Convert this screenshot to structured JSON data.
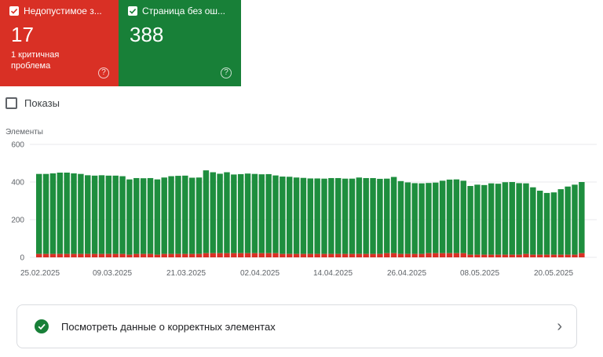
{
  "cards": {
    "invalid": {
      "label": "Недопустимое з...",
      "count": "17",
      "sub": "1 критичная проблема",
      "color": "#d93025"
    },
    "valid": {
      "label": "Страница без ош...",
      "count": "388",
      "color": "#188038"
    }
  },
  "shows_label": "Показы",
  "bottom_link": {
    "label": "Посмотреть данные о корректных элементах"
  },
  "chart_data": {
    "type": "bar",
    "ylabel": "Элементы",
    "ylim": [
      0,
      600
    ],
    "yticks": [
      "600",
      "400",
      "200",
      "0"
    ],
    "xticks": [
      "25.02.2025",
      "09.03.2025",
      "21.03.2025",
      "02.04.2025",
      "14.04.2025",
      "26.04.2025",
      "08.05.2025",
      "20.05.2025"
    ],
    "colors": {
      "valid": "#1e8e3e",
      "invalid": "#d93025"
    },
    "series": [
      {
        "values": [
          425,
          425,
          428,
          432,
          432,
          428,
          425,
          418,
          416,
          418,
          416,
          416,
          413,
          400,
          403,
          402,
          403,
          400,
          406,
          413,
          415,
          416,
          405,
          406,
          440,
          430,
          422,
          430,
          418,
          420,
          423,
          421,
          419,
          420,
          413,
          411,
          410,
          406,
          404,
          401,
          401,
          400,
          403,
          403,
          400,
          400,
          406,
          403,
          403,
          399,
          396,
          405,
          387,
          380,
          376,
          375,
          373,
          375,
          385,
          391,
          392,
          385,
          365,
          372,
          370,
          379,
          377,
          385,
          386,
          380,
          375,
          358,
          340,
          328,
          331,
          348,
          362,
          372,
          378
        ]
      },
      {
        "values": [
          18,
          18,
          18,
          18,
          18,
          18,
          18,
          18,
          18,
          18,
          18,
          18,
          18,
          14,
          18,
          18,
          18,
          14,
          18,
          18,
          18,
          18,
          18,
          18,
          22,
          22,
          22,
          22,
          22,
          22,
          22,
          22,
          22,
          22,
          22,
          18,
          18,
          18,
          18,
          18,
          18,
          18,
          18,
          18,
          18,
          18,
          18,
          18,
          18,
          18,
          22,
          22,
          18,
          18,
          18,
          18,
          22,
          22,
          22,
          22,
          22,
          22,
          14,
          14,
          14,
          14,
          14,
          14,
          14,
          14,
          18,
          14,
          14,
          14,
          14,
          14,
          14,
          14,
          22
        ]
      }
    ]
  }
}
